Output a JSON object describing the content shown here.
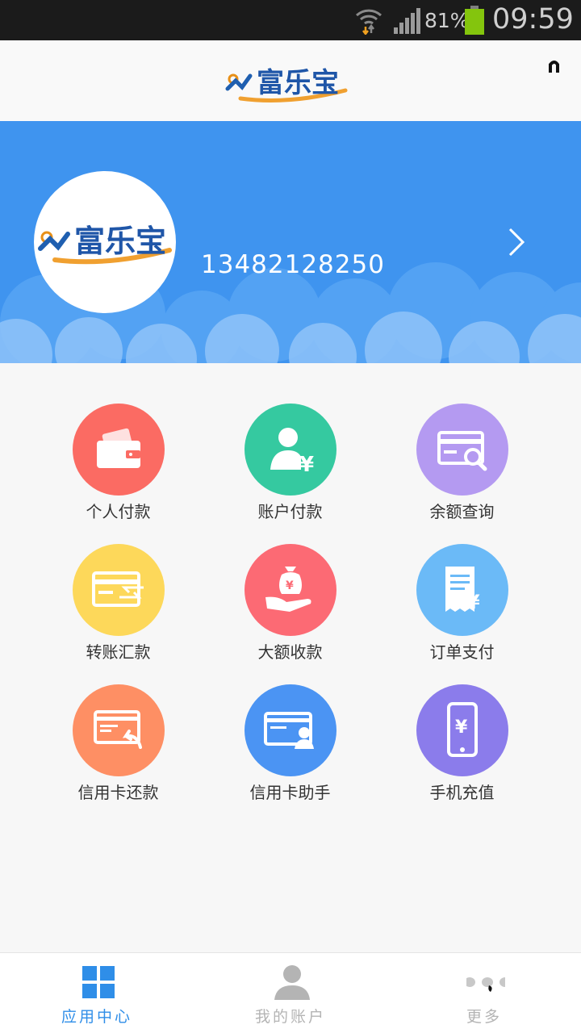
{
  "status_bar": {
    "battery_percent": "81%",
    "time": "09:59"
  },
  "header": {
    "logo_text": "富乐宝"
  },
  "profile": {
    "logo_text": "富乐宝",
    "phone": "13482128250"
  },
  "colors": {
    "banner": "#3f94ef",
    "tab_active": "#2f8ee8",
    "tab_inactive": "#b4b4b4"
  },
  "services": [
    {
      "label": "个人付款",
      "icon": "wallet-icon",
      "color": "#fb6b63"
    },
    {
      "label": "账户付款",
      "icon": "user-yuan-icon",
      "color": "#35c9a0"
    },
    {
      "label": "余额查询",
      "icon": "card-search-icon",
      "color": "#b49af1"
    },
    {
      "label": "转账汇款",
      "icon": "card-transfer-icon",
      "color": "#fdd85a"
    },
    {
      "label": "大额收款",
      "icon": "money-bag-hand-icon",
      "color": "#fc6a74"
    },
    {
      "label": "订单支付",
      "icon": "receipt-yuan-icon",
      "color": "#6bbaf7"
    },
    {
      "label": "信用卡还款",
      "icon": "card-return-icon",
      "color": "#fe8f64"
    },
    {
      "label": "信用卡助手",
      "icon": "card-person-icon",
      "color": "#4b94f3"
    },
    {
      "label": "手机充值",
      "icon": "phone-yuan-icon",
      "color": "#8b7ceb"
    }
  ],
  "tabs": [
    {
      "label": "应用中心",
      "icon": "grid-icon",
      "active": true
    },
    {
      "label": "我的账户",
      "icon": "person-icon",
      "active": false
    },
    {
      "label": "更多",
      "icon": "more-dots-icon",
      "active": false
    }
  ]
}
